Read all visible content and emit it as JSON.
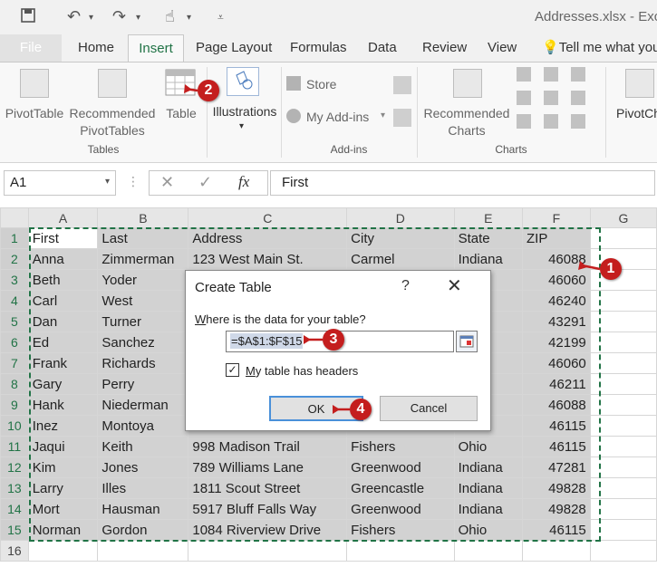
{
  "window": {
    "file_title": "Addresses.xlsx - Excel"
  },
  "tabs": [
    {
      "label": "File"
    },
    {
      "label": "Home"
    },
    {
      "label": "Insert"
    },
    {
      "label": "Page Layout"
    },
    {
      "label": "Formulas"
    },
    {
      "label": "Data"
    },
    {
      "label": "Review"
    },
    {
      "label": "View"
    }
  ],
  "tell_me": "Tell me what you",
  "ribbon": {
    "pivottable": "PivotTable",
    "recommended_pivot_1": "Recommended",
    "recommended_pivot_2": "PivotTables",
    "table": "Table",
    "illustrations": "Illustrations",
    "store": "Store",
    "my_addins": "My Add-ins",
    "recommended_charts_1": "Recommended",
    "recommended_charts_2": "Charts",
    "pivotchart": "PivotCh",
    "groups": {
      "tables": "Tables",
      "addins": "Add-ins",
      "charts": "Charts"
    }
  },
  "formula_bar": {
    "name_box": "A1",
    "fx": "fx",
    "content": "First"
  },
  "columns": [
    "A",
    "B",
    "C",
    "D",
    "E",
    "F",
    "G"
  ],
  "rows": [
    [
      "First",
      "Last",
      "Address",
      "City",
      "State",
      "ZIP"
    ],
    [
      "Anna",
      "Zimmerman",
      "123 West Main St.",
      "Carmel",
      "Indiana",
      "46088"
    ],
    [
      "Beth",
      "Yoder",
      "",
      "",
      "iana",
      "46060"
    ],
    [
      "Carl",
      "West",
      "",
      "",
      "iana",
      "46240"
    ],
    [
      "Dan",
      "Turner",
      "",
      "",
      "o",
      "43291"
    ],
    [
      "Ed",
      "Sanchez",
      "",
      "",
      "o",
      "42199"
    ],
    [
      "Frank",
      "Richards",
      "",
      "",
      "iana",
      "46060"
    ],
    [
      "Gary",
      "Perry",
      "",
      "",
      "iana",
      "46211"
    ],
    [
      "Hank",
      "Niederman",
      "",
      "",
      "iana",
      "46088"
    ],
    [
      "Inez",
      "Montoya",
      "",
      "",
      "o",
      "46115"
    ],
    [
      "Jaqui",
      "Keith",
      "998 Madison Trail",
      "Fishers",
      "Ohio",
      "46115"
    ],
    [
      "Kim",
      "Jones",
      "789 Williams Lane",
      "Greenwood",
      "Indiana",
      "47281"
    ],
    [
      "Larry",
      "Illes",
      "1811 Scout Street",
      "Greencastle",
      "Indiana",
      "49828"
    ],
    [
      "Mort",
      "Hausman",
      "5917 Bluff Falls Way",
      "Greenwood",
      "Indiana",
      "49828"
    ],
    [
      "Norman",
      "Gordon",
      "1084 Riverview Drive",
      "Fishers",
      "Ohio",
      "46115"
    ]
  ],
  "row_16": "16",
  "dialog": {
    "title": "Create Table",
    "help": "?",
    "close": "✕",
    "question": "Where is the data for your table?",
    "range": "=$A$1:$F$15",
    "checkbox_label": "My table has headers",
    "checked": true,
    "ok": "OK",
    "cancel": "Cancel"
  },
  "callouts": [
    "1",
    "2",
    "3",
    "4"
  ],
  "accent_color": "#217346",
  "callout_color": "#c41e1e"
}
